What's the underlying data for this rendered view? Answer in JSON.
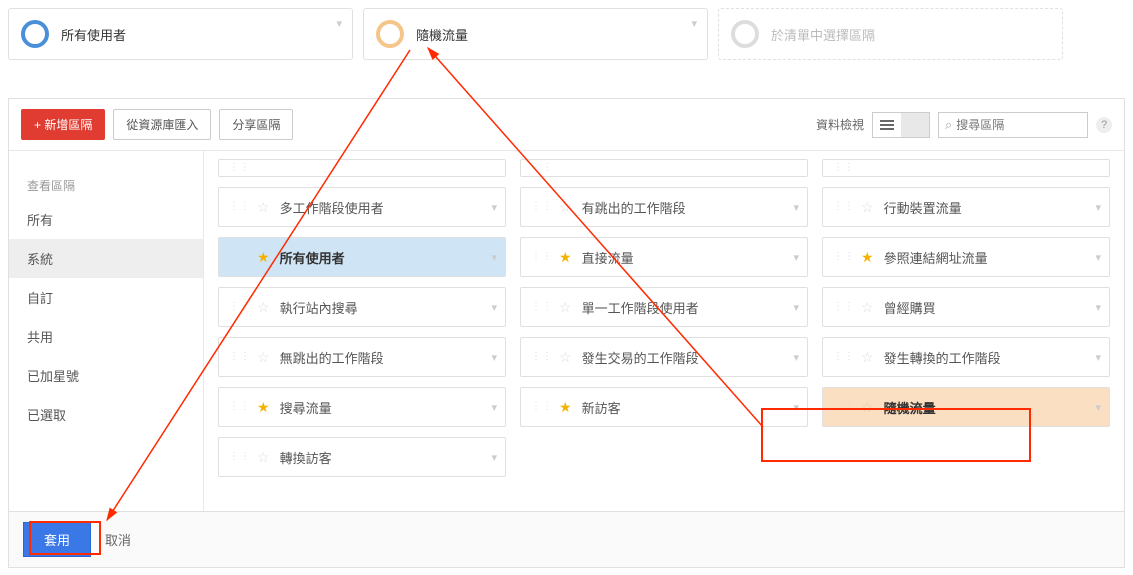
{
  "top_selectors": [
    {
      "label": "所有使用者",
      "circle": "blue"
    },
    {
      "label": "隨機流量",
      "circle": "orange"
    },
    {
      "label": "於清單中選擇區隔",
      "circle": "grey",
      "dashed": true
    }
  ],
  "toolbar": {
    "new_segment": "+ 新增區隔",
    "import_library": "從資源庫匯入",
    "share_segment": "分享區隔",
    "view_label": "資料檢視",
    "search_placeholder": "搜尋區隔"
  },
  "sidebar": {
    "header": "查看區隔",
    "items": [
      "所有",
      "系統",
      "自訂",
      "共用",
      "已加星號",
      "已選取"
    ],
    "active_index": 1
  },
  "segments": [
    {
      "label": "多工作階段使用者",
      "starred": false
    },
    {
      "label": "有跳出的工作階段",
      "starred": false
    },
    {
      "label": "行動裝置流量",
      "starred": false
    },
    {
      "label": "所有使用者",
      "starred": true,
      "selected": "blue"
    },
    {
      "label": "直接流量",
      "starred": true
    },
    {
      "label": "參照連結網址流量",
      "starred": true
    },
    {
      "label": "執行站內搜尋",
      "starred": false
    },
    {
      "label": "單一工作階段使用者",
      "starred": false
    },
    {
      "label": "曾經購買",
      "starred": false
    },
    {
      "label": "無跳出的工作階段",
      "starred": false
    },
    {
      "label": "發生交易的工作階段",
      "starred": false
    },
    {
      "label": "發生轉換的工作階段",
      "starred": false
    },
    {
      "label": "搜尋流量",
      "starred": true
    },
    {
      "label": "新訪客",
      "starred": true
    },
    {
      "label": "隨機流量",
      "starred": false,
      "selected": "orange"
    },
    {
      "label": "轉換訪客",
      "starred": false
    }
  ],
  "footer": {
    "apply": "套用",
    "cancel": "取消"
  }
}
